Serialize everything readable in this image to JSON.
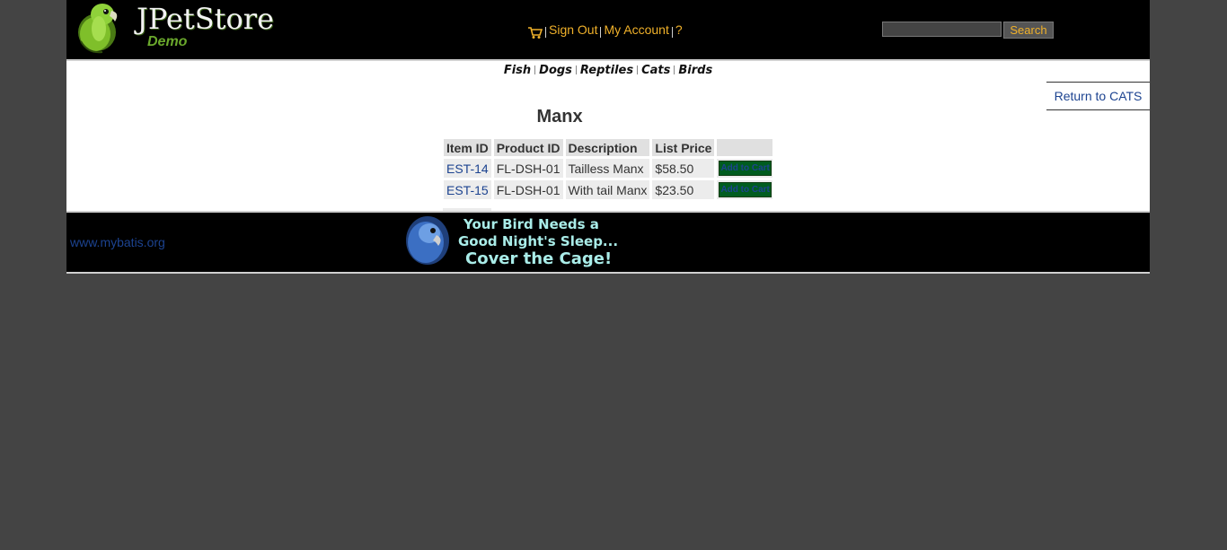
{
  "header": {
    "logo_title": "JPetStore",
    "logo_subtitle": "Demo",
    "menu": {
      "sign_out": "Sign Out",
      "my_account": "My Account",
      "help": "?"
    },
    "search": {
      "value": "",
      "button_label": "Search"
    }
  },
  "quicklinks": [
    "Fish",
    "Dogs",
    "Reptiles",
    "Cats",
    "Birds"
  ],
  "content": {
    "back_link": "Return to CATS",
    "product_name": "Manx",
    "columns": [
      "Item ID",
      "Product ID",
      "Description",
      "List Price",
      ""
    ],
    "items": [
      {
        "item_id": "EST-14",
        "product_id": "FL-DSH-01",
        "description": "Tailless Manx",
        "price": "$58.50",
        "button": "Add to Cart"
      },
      {
        "item_id": "EST-15",
        "product_id": "FL-DSH-01",
        "description": "With tail Manx",
        "price": "$23.50",
        "button": "Add to Cart"
      }
    ]
  },
  "footer": {
    "link": "www.mybatis.org",
    "banner_lines": [
      "Your Bird Needs a",
      "Good Night's Sleep...",
      "Cover the Cage!"
    ]
  },
  "colors": {
    "background": "#444444",
    "header_bg": "#000000",
    "menu_link": "#f0b12a",
    "link": "#1c4390",
    "cart_button": "#005c1f",
    "banner_text": "#a9ece8"
  },
  "icons": {
    "logo": "parrot-logo-icon",
    "cart": "shopping-cart-icon",
    "banner": "parrot-banner-image"
  }
}
